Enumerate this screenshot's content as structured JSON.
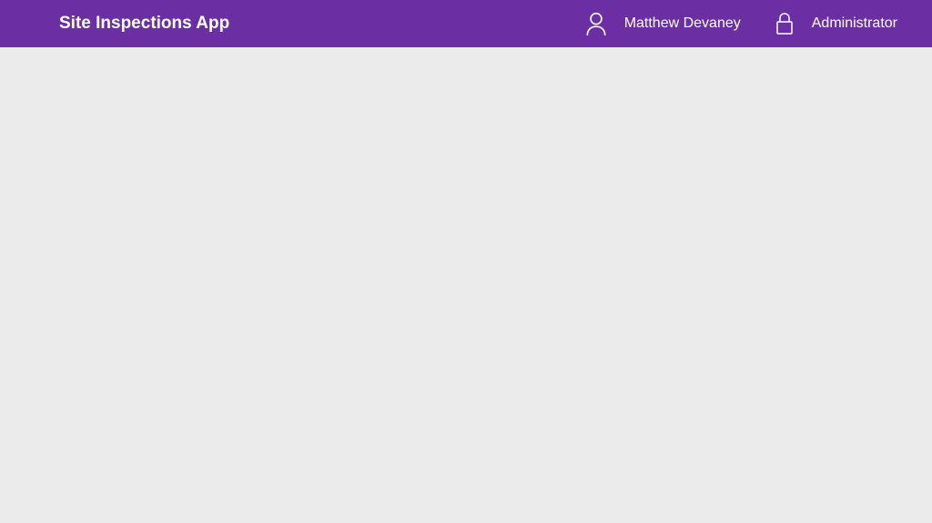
{
  "header": {
    "app_title": "Site Inspections App",
    "user_name": "Matthew Devaney",
    "role_label": "Administrator"
  }
}
